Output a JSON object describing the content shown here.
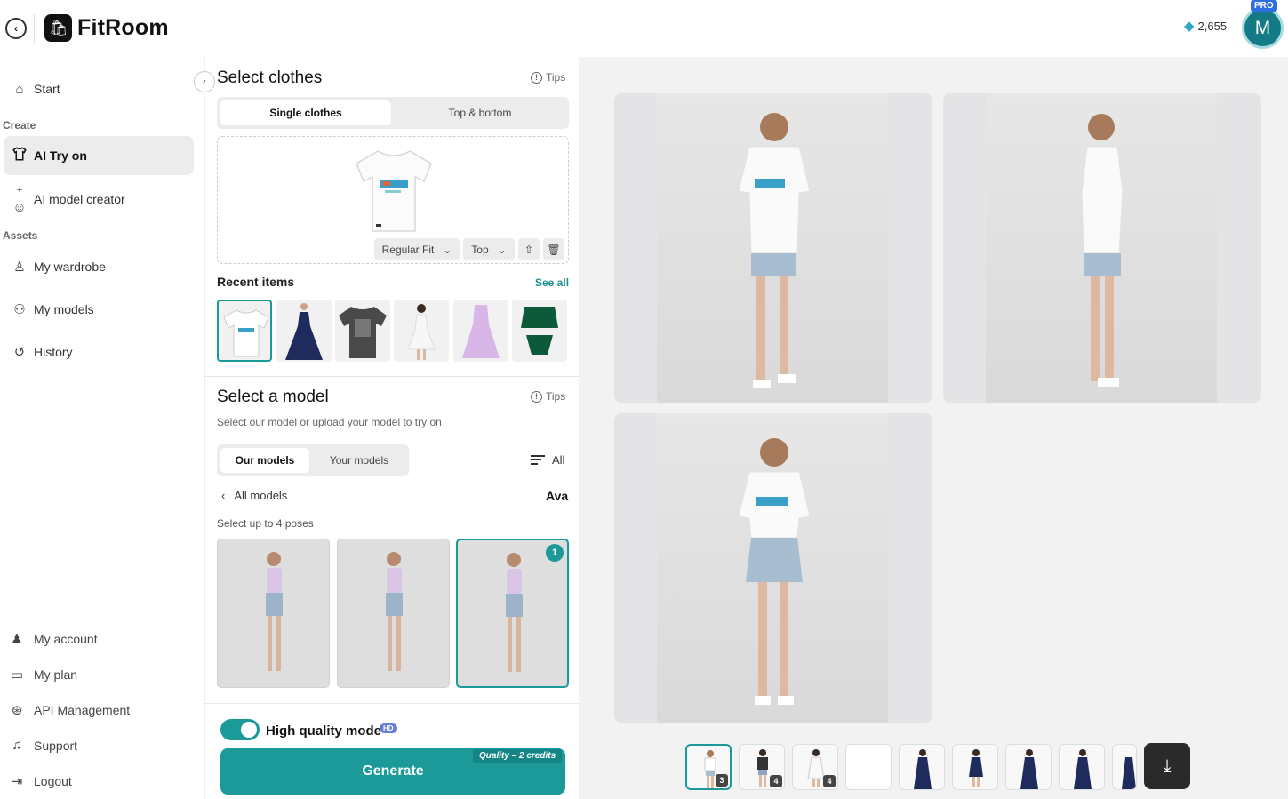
{
  "header": {
    "back_glyph": "‹",
    "logo_glyph": "🛍",
    "app_name": "FitRoom",
    "credits": "2,655",
    "avatar_initial": "M",
    "pro_badge": "PRO"
  },
  "sidebar": {
    "start": "Start",
    "create_label": "Create",
    "ai_try_on": "AI Try on",
    "ai_model_creator": "AI model creator",
    "assets_label": "Assets",
    "my_wardrobe": "My wardrobe",
    "my_models": "My models",
    "history": "History",
    "bottom": [
      {
        "label": "My account",
        "icon": "user-icon"
      },
      {
        "label": "My plan",
        "icon": "card-icon"
      },
      {
        "label": "API Management",
        "icon": "api-icon"
      },
      {
        "label": "Support",
        "icon": "headset-icon"
      },
      {
        "label": "Logout",
        "icon": "logout-icon"
      }
    ]
  },
  "clothes": {
    "title": "Select clothes",
    "tips": "Tips",
    "tabs": [
      "Single clothes",
      "Top & bottom"
    ],
    "active_tab": "Single clothes",
    "fit_select": "Regular Fit",
    "type_select": "Top",
    "recent_title": "Recent items",
    "see_all": "See all"
  },
  "model": {
    "title": "Select a model",
    "tips": "Tips",
    "subtitle": "Select our model or upload your model to try on",
    "tabs": [
      "Our models",
      "Your models"
    ],
    "active_tab": "Our models",
    "filter": "All",
    "breadcrumb": "All models",
    "model_name": "Ava",
    "poses_hint": "Select up to 4 poses",
    "selected_pose_number": "1"
  },
  "footer": {
    "hq_label": "High quality mode",
    "hd_badge": "HD",
    "hq_enabled": true,
    "generate": "Generate",
    "quality_tag": "Quality – 2 credits"
  },
  "results": {
    "strip_counts": [
      "3",
      "4",
      "4"
    ]
  },
  "colors": {
    "accent": "#1c9a9a",
    "avatar": "#147a86",
    "pro": "#2d6ee0"
  }
}
